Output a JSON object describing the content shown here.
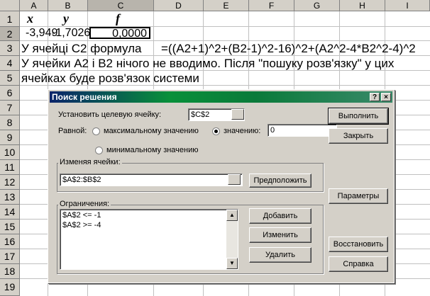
{
  "columns": [
    "A",
    "B",
    "C",
    "D",
    "E",
    "F",
    "G",
    "H",
    "I"
  ],
  "rows": [
    "1",
    "2",
    "3",
    "4",
    "5",
    "6",
    "7",
    "8",
    "9",
    "10",
    "11",
    "12",
    "13",
    "14",
    "15",
    "16",
    "17",
    "18",
    "19"
  ],
  "cells": {
    "A1": "x",
    "B1": "y",
    "C1": "f",
    "A2": "-3,949",
    "B2": "-1,7026",
    "C2": "0,0000",
    "A3": "У ячейці С2 формула",
    "D3": "=((A2+1)^2+(B2-1)^2-16)^2+(A2^2-4*B2^2-4)^2",
    "A4": "У ячейки А2 і В2 нічого не вводимо. Після \"пошуку розв'язку\" у цих",
    "A5": "ячейках буде розв'язок системи"
  },
  "dialog": {
    "title": "Поиск решения",
    "help_button": "?",
    "close_button": "×",
    "target_label": "Установить целевую ячейку:",
    "target_value": "$C$2",
    "equal_label": "Равной:",
    "radio_max": "максимальному значению",
    "radio_value": "значению:",
    "value_field": "0",
    "radio_min": "минимальному значению",
    "changing_label": "Изменяя ячейки:",
    "changing_value": "$A$2:$B$2",
    "guess_button": "Предположить",
    "constraints_label": "Ограничения:",
    "constraints": [
      "$A$2 <= -1",
      "$A$2 >= -4"
    ],
    "add_button": "Добавить",
    "change_button": "Изменить",
    "delete_button": "Удалить",
    "solve_button": "Выполнить",
    "close_label": "Закрыть",
    "options_button": "Параметры",
    "reset_button": "Восстановить",
    "help_label": "Справка",
    "selected_radio": "value"
  }
}
